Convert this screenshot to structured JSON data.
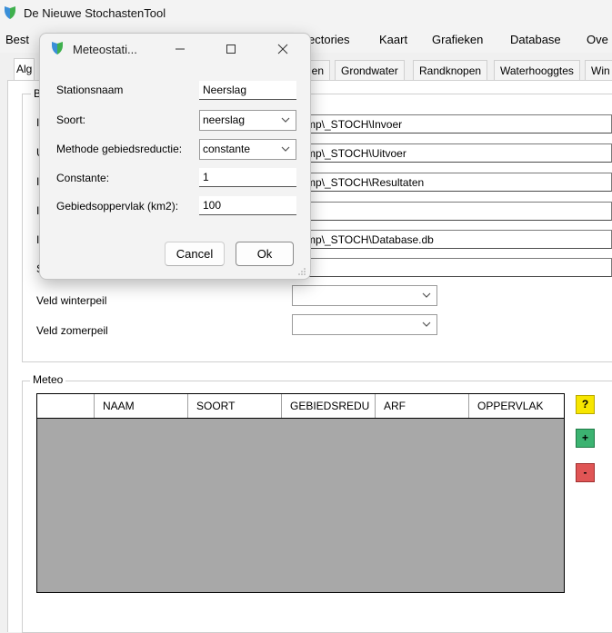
{
  "app": {
    "title": "De Nieuwe StochastenTool"
  },
  "menu": [
    "Best",
    "ectories",
    "Kaart",
    "Grafieken",
    "Database",
    "Ove"
  ],
  "tabs": [
    "Alg",
    "nen",
    "Grondwater",
    "Randknopen",
    "Waterhooggtes",
    "Win"
  ],
  "paths": {
    "invoer": "temp\\_STOCH\\Invoer",
    "uitvoer": "temp\\_STOCH\\Uitvoer",
    "resultaten": "temp\\_STOCH\\Resultaten",
    "empty": "",
    "database": "temp\\_STOCH\\Database.db",
    "empty2": ""
  },
  "left_letters": [
    "B",
    "I",
    "U",
    "I",
    "I",
    "I",
    "S"
  ],
  "peil": {
    "winter_label": "Veld winterpeil",
    "zomer_label": "Veld zomerpeil"
  },
  "meteo": {
    "group_label": "Meteo",
    "columns": [
      "",
      "NAAM",
      "SOORT",
      "GEBIEDSREDU",
      "ARF",
      "OPPERVLAK"
    ],
    "help_label": "?",
    "add_label": "+",
    "remove_label": "-"
  },
  "dialog": {
    "title": "Meteostati...",
    "fields": {
      "stationsnaam_label": "Stationsnaam",
      "stationsnaam_value": "Neerslag",
      "soort_label": "Soort:",
      "soort_value": "neerslag",
      "methode_label": "Methode gebiedsreductie:",
      "methode_value": "constante",
      "constante_label": "Constante:",
      "constante_value": "1",
      "oppervlak_label": "Gebiedsoppervlak (km2):",
      "oppervlak_value": "100"
    },
    "cancel_label": "Cancel",
    "ok_label": "Ok"
  },
  "colors": {
    "help": "#f7e600",
    "add": "#3cb371",
    "remove": "#e05555",
    "grid_bg": "#a8a8a8"
  }
}
